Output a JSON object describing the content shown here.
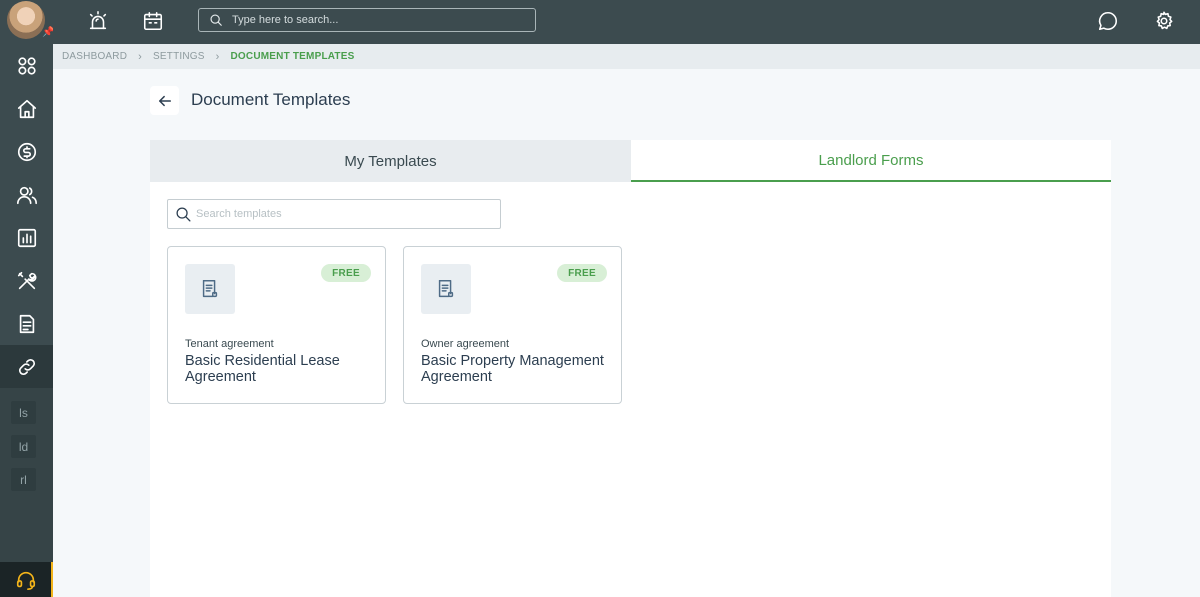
{
  "topbar": {
    "search_placeholder": "Type here to search...",
    "icons": [
      "alarm-light-icon",
      "calendar-icon",
      "chat-icon",
      "gear-icon"
    ]
  },
  "sidebar": {
    "items": [
      {
        "name": "dashboard",
        "icon": "apps-grid-icon"
      },
      {
        "name": "home",
        "icon": "home-icon"
      },
      {
        "name": "accounting",
        "icon": "dollar-circle-icon"
      },
      {
        "name": "people",
        "icon": "people-icon"
      },
      {
        "name": "reports",
        "icon": "bar-chart-icon"
      },
      {
        "name": "maintenance",
        "icon": "tools-icon"
      },
      {
        "name": "documents",
        "icon": "document-icon"
      },
      {
        "name": "links",
        "icon": "link-icon"
      }
    ],
    "mini_items": [
      "ls",
      "ld",
      "rl"
    ],
    "support_icon": "headset-icon"
  },
  "breadcrumb": {
    "items": [
      "DASHBOARD",
      "SETTINGS",
      "DOCUMENT TEMPLATES"
    ]
  },
  "page": {
    "title": "Document Templates"
  },
  "tabs": [
    {
      "label": "My Templates",
      "active": false
    },
    {
      "label": "Landlord Forms",
      "active": true
    }
  ],
  "template_search": {
    "placeholder": "Search templates"
  },
  "templates": [
    {
      "kind": "Tenant agreement",
      "name": "Basic Residential Lease Agreement",
      "badge": "FREE"
    },
    {
      "kind": "Owner agreement",
      "name": "Basic Property Management Agreement",
      "badge": "FREE"
    }
  ],
  "colors": {
    "accent_green": "#4a9e4d",
    "sidebar_bg": "#3c4b4f",
    "support_accent": "#f3b41a",
    "badge_bg": "#d8efd6"
  }
}
